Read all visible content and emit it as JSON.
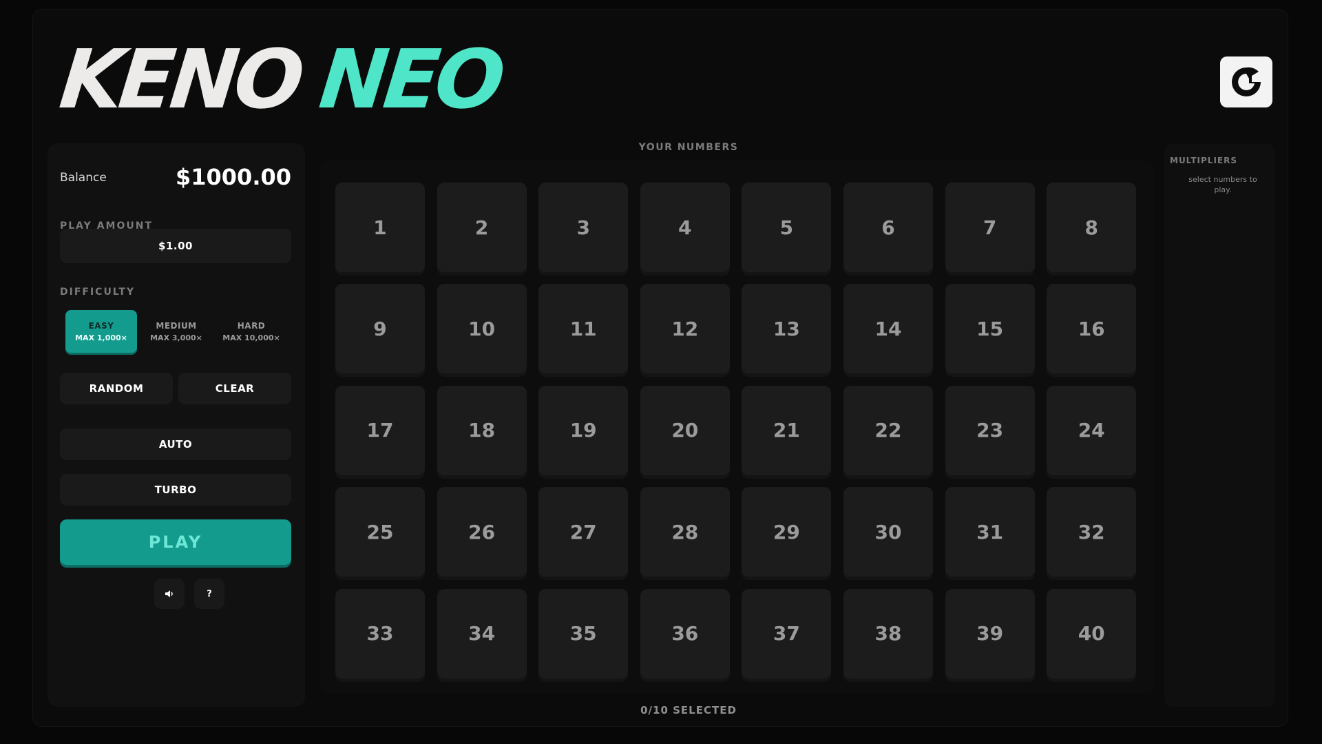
{
  "logo": {
    "word1": "KENO",
    "word2": "NEO"
  },
  "brand_icon": "brand-logo-icon",
  "balance": {
    "label": "Balance",
    "value": "$1000.00"
  },
  "play_amount": {
    "label": "PLAY AMOUNT",
    "value": "$1.00"
  },
  "difficulty": {
    "label": "DIFFICULTY",
    "selected": "EASY",
    "options": [
      {
        "title": "EASY",
        "max": "MAX 1,000×"
      },
      {
        "title": "MEDIUM",
        "max": "MAX 3,000×"
      },
      {
        "title": "HARD",
        "max": "MAX 10,000×"
      }
    ]
  },
  "buttons": {
    "random": "RANDOM",
    "clear": "CLEAR",
    "auto": "AUTO",
    "turbo": "TURBO",
    "play": "PLAY",
    "sound_icon": "speaker-icon",
    "help": "?"
  },
  "board": {
    "label": "YOUR NUMBERS",
    "numbers": [
      1,
      2,
      3,
      4,
      5,
      6,
      7,
      8,
      9,
      10,
      11,
      12,
      13,
      14,
      15,
      16,
      17,
      18,
      19,
      20,
      21,
      22,
      23,
      24,
      25,
      26,
      27,
      28,
      29,
      30,
      31,
      32,
      33,
      34,
      35,
      36,
      37,
      38,
      39,
      40
    ],
    "selected_text": "0/10 SELECTED"
  },
  "multipliers": {
    "title": "MULTIPLIERS",
    "hint": "select numbers to play."
  },
  "colors": {
    "accent": "#139c8e",
    "logo_accent": "#4fe5c8",
    "background": "#0b0b0b",
    "tile": "#1c1c1c"
  }
}
